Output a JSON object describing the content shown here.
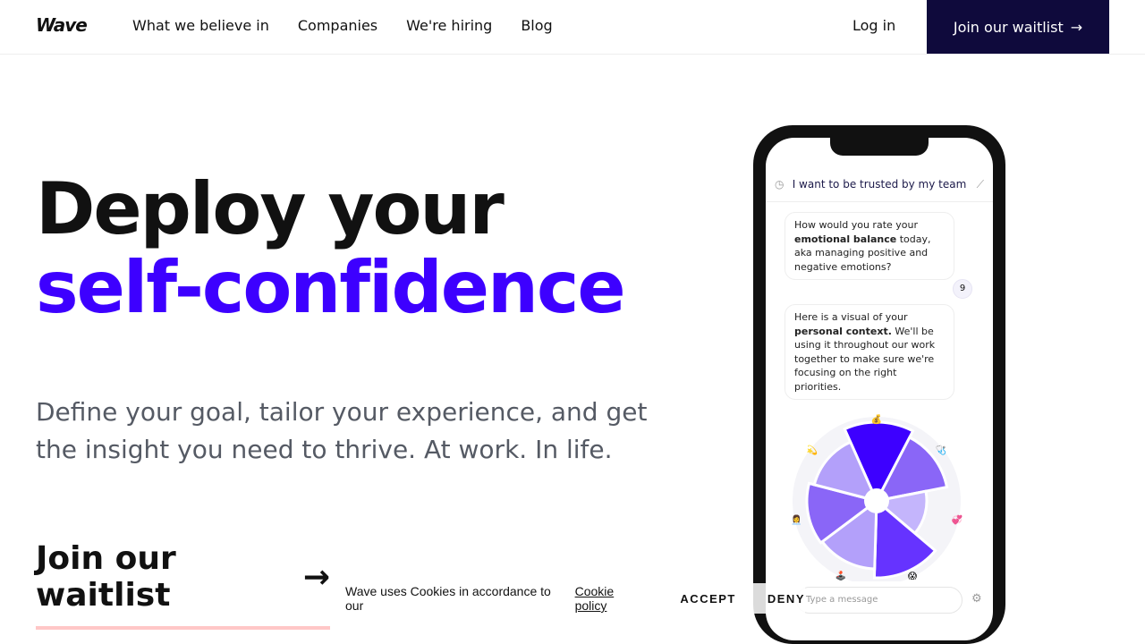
{
  "nav": {
    "logo": "Wave",
    "links": [
      "What we believe in",
      "Companies",
      "We're hiring",
      "Blog"
    ],
    "login": "Log in",
    "cta": "Join our waitlist"
  },
  "hero": {
    "title_line1": "Deploy your",
    "title_line2": "self-confidence",
    "subtitle": "Define your goal, tailor your experience, and get the insight you need to thrive. At work. In life.",
    "cta": "Join our waitlist",
    "accent": "#3d00ff"
  },
  "phone": {
    "header": "I want to be trusted by my team",
    "msg1": {
      "pre": "How would you rate your ",
      "bold": "emotional balance",
      "post": " today, aka managing positive and negative emotions?"
    },
    "reply": "9",
    "msg2": {
      "pre": "Here is a visual of your ",
      "bold": "personal context.",
      "post": " We'll be using it throughout our work together to make sure we're focusing on the right priorities."
    },
    "input_placeholder": "Type a message",
    "wheel_emojis": [
      "💰",
      "🩺",
      "💞",
      "😱",
      "🕹️",
      "👩‍💼",
      "💫"
    ]
  },
  "cookie": {
    "text": "Wave uses Cookies in accordance to our",
    "link": "Cookie policy",
    "accept": "ACCEPT",
    "deny": "DENY"
  }
}
